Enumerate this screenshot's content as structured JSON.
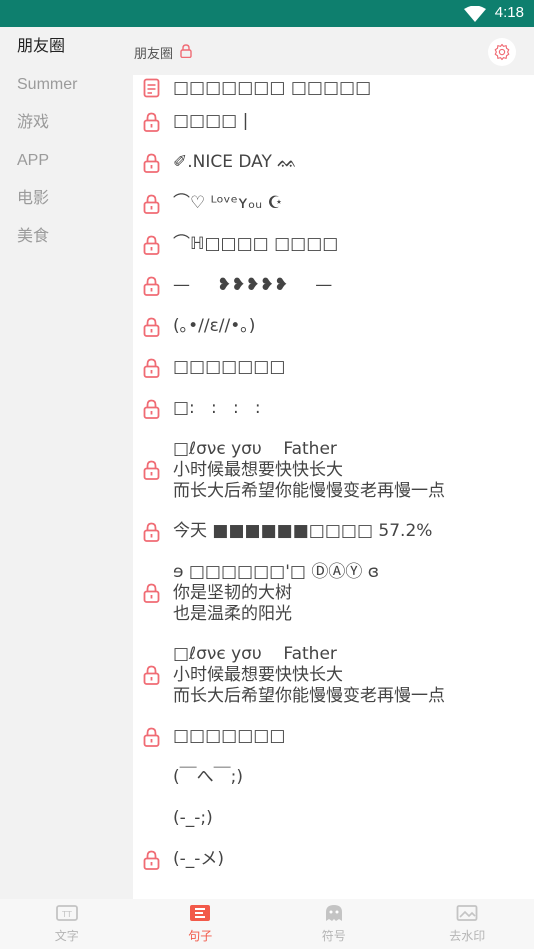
{
  "status_bar": {
    "time": "4:18"
  },
  "sidebar": {
    "items": [
      {
        "label": "朋友圈",
        "active": true
      },
      {
        "label": "Summer",
        "active": false
      },
      {
        "label": "游戏",
        "active": false
      },
      {
        "label": "APP",
        "active": false
      },
      {
        "label": "电影",
        "active": false
      },
      {
        "label": "美食",
        "active": false
      }
    ]
  },
  "header": {
    "title": "朋友圈"
  },
  "list": {
    "items": [
      {
        "text": "□□□□□□□ □□□□□",
        "icon": "note-icon"
      },
      {
        "text": "□□□□ |",
        "icon": "lock-icon"
      },
      {
        "text": "✐.NICE DAY ᨐ",
        "icon": "lock-icon"
      },
      {
        "text": "⌒♡ ᴸᵒᵛᵉʏₒᵤ ☪",
        "icon": "lock-icon"
      },
      {
        "text": "⌒ℍ□□□□ □□□□",
        "icon": "lock-icon"
      },
      {
        "text": "—     ❥❥❥❥❥     —",
        "icon": "lock-icon"
      },
      {
        "text": "(｡•//ε//•｡)",
        "icon": "lock-icon"
      },
      {
        "text": "□□□□□□□",
        "icon": "lock-icon"
      },
      {
        "text": "□:   :   :   :",
        "icon": "lock-icon"
      },
      {
        "text": "□ℓσνє уσυ    Father\n小时候最想要快快长大\n而长大后希望你能慢慢变老再慢一点",
        "icon": "lock-icon"
      },
      {
        "text": "今天 ■■■■■■□□□□ 57.2%",
        "icon": "lock-icon"
      },
      {
        "text": "ɘ □□□□□□'□ ⒹⒶⓎ ɞ\n你是坚韧的大树\n也是温柔的阳光",
        "icon": "lock-icon"
      },
      {
        "text": "□ℓσνє уσυ    Father\n小时候最想要快快长大\n而长大后希望你能慢慢变老再慢一点",
        "icon": "lock-icon"
      },
      {
        "text": "□□□□□□□",
        "icon": "lock-icon"
      },
      {
        "text": "(￣へ￣;)",
        "icon": ""
      },
      {
        "text": "(-_-;)",
        "icon": ""
      },
      {
        "text": "(-_-メ)",
        "icon": "lock-icon"
      }
    ]
  },
  "bottom_nav": {
    "items": [
      {
        "label": "文字",
        "active": false
      },
      {
        "label": "句子",
        "active": true
      },
      {
        "label": "符号",
        "active": false
      },
      {
        "label": "去水印",
        "active": false
      }
    ]
  },
  "colors": {
    "accent": "#f25a4a",
    "status_bar": "#0e7f6e",
    "lock": "#f06b74"
  }
}
